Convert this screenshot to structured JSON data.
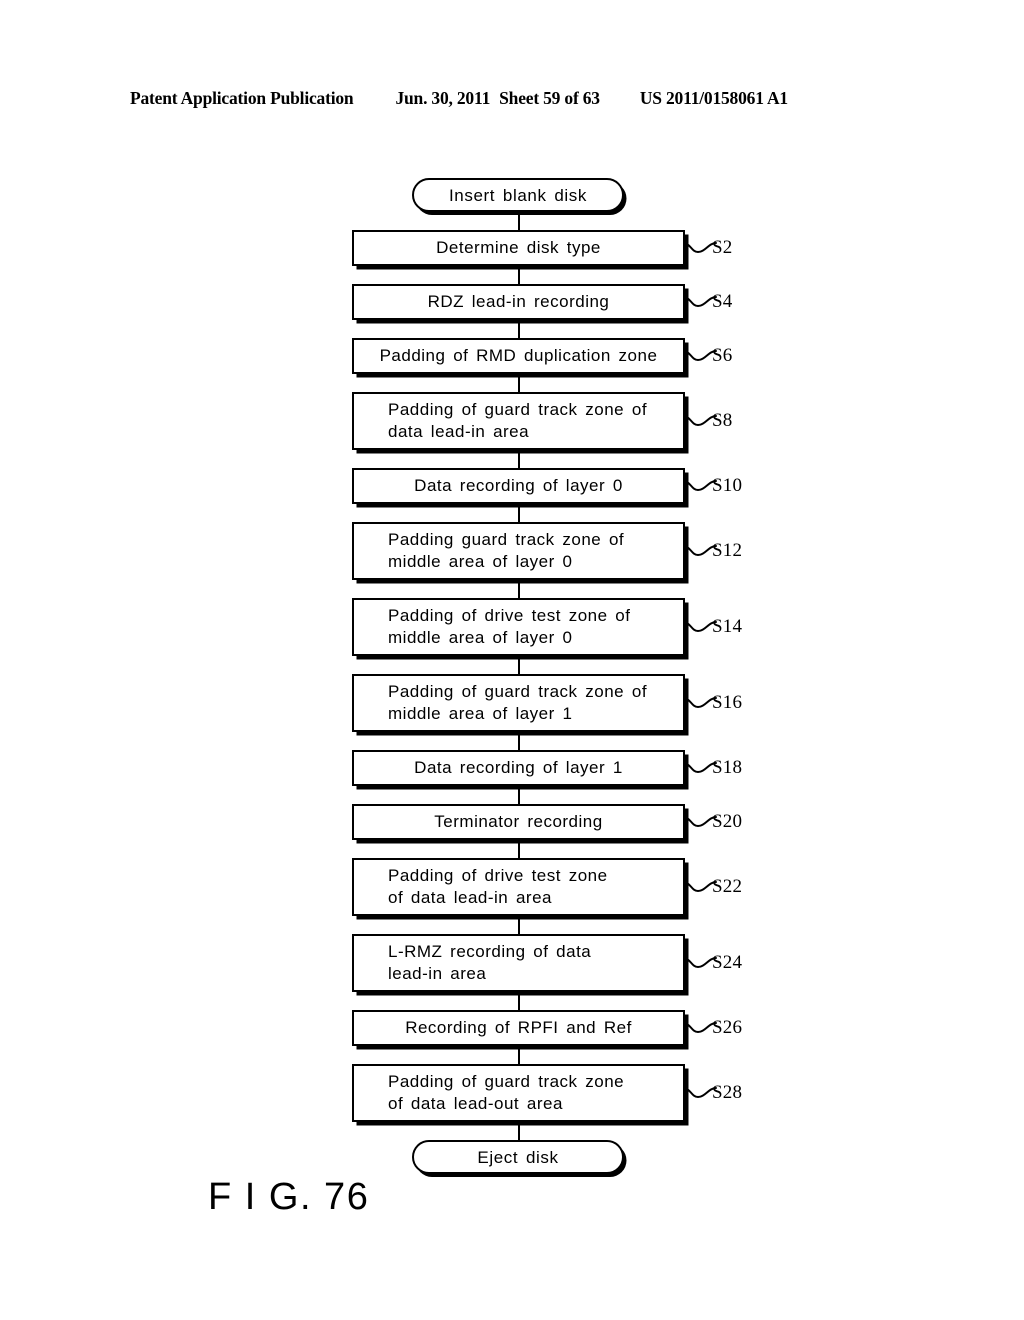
{
  "header": {
    "publication": "Patent Application Publication",
    "date": "Jun. 30, 2011",
    "sheet": "Sheet 59 of 63",
    "doc_number": "US 2011/0158061 A1"
  },
  "figure": {
    "caption": "F I G. 76"
  },
  "flowchart": {
    "start": {
      "label": "Insert blank disk",
      "shape": "terminal"
    },
    "end": {
      "label": "Eject disk",
      "shape": "terminal"
    },
    "steps": [
      {
        "step": "S2",
        "label": "Determine disk type",
        "lines": 1
      },
      {
        "step": "S4",
        "label": "RDZ lead-in recording",
        "lines": 1
      },
      {
        "step": "S6",
        "label": "Padding of RMD duplication zone",
        "lines": 1
      },
      {
        "step": "S8",
        "label": "Padding of guard track zone of\ndata lead-in area",
        "lines": 2
      },
      {
        "step": "S10",
        "label": "Data recording of layer 0",
        "lines": 1
      },
      {
        "step": "S12",
        "label": "Padding guard track zone of\nmiddle area of layer 0",
        "lines": 2
      },
      {
        "step": "S14",
        "label": "Padding of drive test zone of\nmiddle area of layer 0",
        "lines": 2
      },
      {
        "step": "S16",
        "label": "Padding of guard track zone of\nmiddle area of layer 1",
        "lines": 2
      },
      {
        "step": "S18",
        "label": "Data recording of layer 1",
        "lines": 1
      },
      {
        "step": "S20",
        "label": "Terminator recording",
        "lines": 1
      },
      {
        "step": "S22",
        "label": "Padding of drive test zone\nof data lead-in area",
        "lines": 2
      },
      {
        "step": "S24",
        "label": "L-RMZ recording of data\nlead-in area",
        "lines": 2
      },
      {
        "step": "S26",
        "label": "Recording of RPFI and Ref",
        "lines": 1
      },
      {
        "step": "S28",
        "label": "Padding of guard track zone\nof data lead-out area",
        "lines": 2
      }
    ]
  },
  "colors": {
    "ink": "#000000",
    "paper": "#ffffff"
  }
}
